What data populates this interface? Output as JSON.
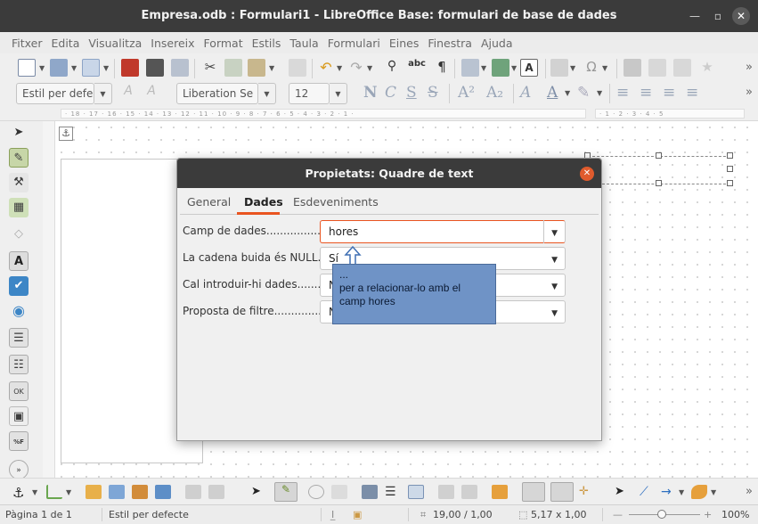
{
  "window": {
    "title": "Empresa.odb : Formulari1 - LibreOffice Base: formulari de base de dades"
  },
  "menubar": [
    "Fitxer",
    "Edita",
    "Visualitza",
    "Insereix",
    "Format",
    "Estils",
    "Taula",
    "Formulari",
    "Eines",
    "Finestra",
    "Ajuda"
  ],
  "format_toolbar": {
    "para_style": "Estil per defe",
    "font_name": "Liberation Se",
    "font_size": "12"
  },
  "ruler": {
    "left_scale": "· 18 · 17 · 16 · 15 · 14 · 13 · 12 · 11 · 10 · 9 · 8 · 7 · 6 · 5 · 4 · 3 · 2 · 1 ·",
    "right_scale": "· 1 · 2 · 3 · 4 · 5"
  },
  "dialog": {
    "title": "Propietats: Quadre de text",
    "close_glyph": "✕",
    "tabs": [
      "General",
      "Dades",
      "Esdeveniments"
    ],
    "active_tab": "Dades",
    "rows": [
      {
        "label": "Camp de dades.....................",
        "value": "hores"
      },
      {
        "label": "La cadena buida és NULL......",
        "value": "Sí"
      },
      {
        "label": "Cal introduir-hi dades.........",
        "value": "N"
      },
      {
        "label": "Proposta de filtre...............",
        "value": "N"
      }
    ]
  },
  "annotation": {
    "line1": "...",
    "line2": "per a relacionar-lo amb el",
    "line3": "camp hores"
  },
  "statusbar": {
    "page": "Pàgina 1 de 1",
    "style": "Estil per defecte",
    "position": "19,00 / 1,00",
    "size": "5,17 x 1,00",
    "zoom": "100%"
  },
  "colors": {
    "accent": "#e95420",
    "callout": "#6f93c6",
    "titlebar": "#3b3b3b"
  }
}
